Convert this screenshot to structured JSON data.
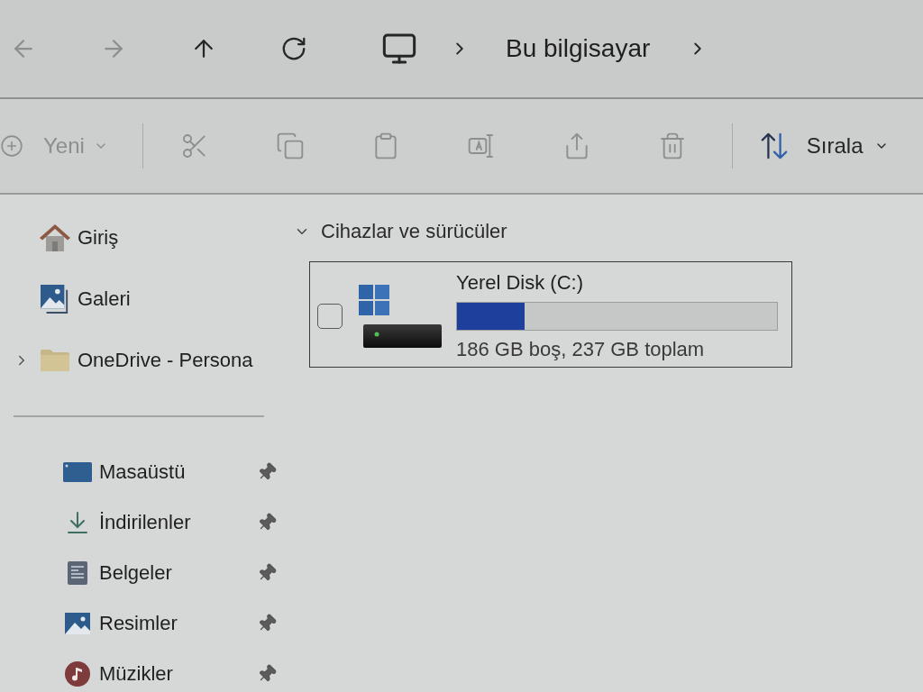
{
  "nav": {
    "buttons": [
      {
        "kind": "back",
        "disabled": true
      },
      {
        "kind": "forward",
        "disabled": true
      },
      {
        "kind": "up",
        "disabled": false
      },
      {
        "kind": "refresh",
        "disabled": false
      }
    ],
    "breadcrumb": [
      {
        "label": "Bu bilgisayar"
      }
    ]
  },
  "command_bar": {
    "new_button": {
      "label": "Yeni",
      "disabled": true
    },
    "actions": [
      {
        "kind": "cut",
        "disabled": true
      },
      {
        "kind": "copy",
        "disabled": true
      },
      {
        "kind": "paste",
        "disabled": true
      },
      {
        "kind": "rename",
        "disabled": true
      },
      {
        "kind": "share",
        "disabled": true
      },
      {
        "kind": "delete",
        "disabled": true
      }
    ],
    "sort_button": {
      "label": "Sırala",
      "disabled": false
    }
  },
  "sidebar": {
    "items": [
      {
        "kind": "home",
        "label": "Giriş"
      },
      {
        "kind": "gallery",
        "label": "Galeri"
      },
      {
        "kind": "folder",
        "label": "OneDrive - Persona",
        "expanded": false
      }
    ],
    "pinned": [
      {
        "kind": "desktop",
        "label": "Masaüstü",
        "pinned": true
      },
      {
        "kind": "downloads",
        "label": "İndirilenler",
        "pinned": true
      },
      {
        "kind": "documents",
        "label": "Belgeler",
        "pinned": true
      },
      {
        "kind": "pictures",
        "label": "Resimler",
        "pinned": true
      },
      {
        "kind": "music",
        "label": "Müzikler",
        "pinned": true
      }
    ]
  },
  "content": {
    "section": {
      "title": "Cihazlar ve sürücüler",
      "expanded": true
    },
    "drives": [
      {
        "name": "Yerel Disk (C:)",
        "checked": false,
        "level": 0.21,
        "reading": "186 GB boş, 237 GB toplam"
      }
    ]
  }
}
